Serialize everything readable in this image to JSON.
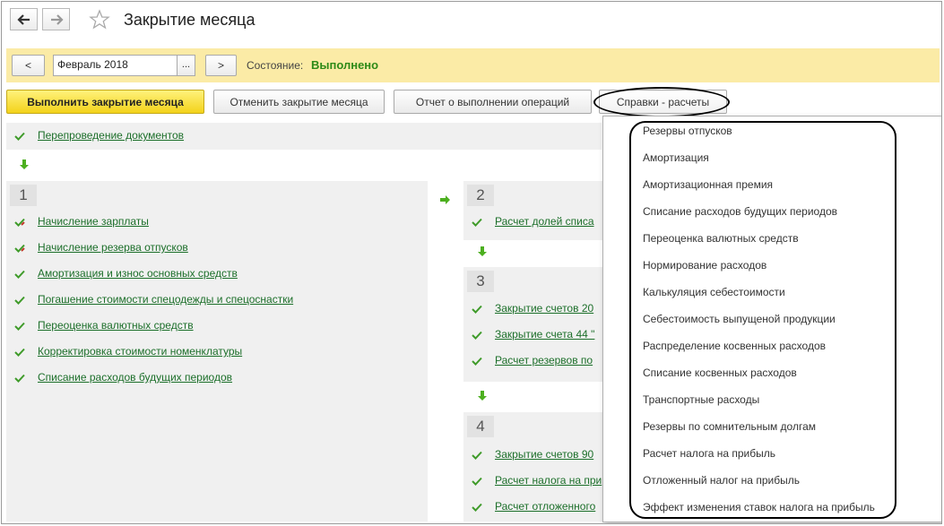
{
  "window": {
    "title": "Закрытие месяца"
  },
  "status": {
    "prev_label": "<",
    "period_value": "Февраль 2018",
    "period_picker": "...",
    "next_label": ">",
    "state_label": "Состояние:",
    "state_value": "Выполнено"
  },
  "toolbar": {
    "run_close": "Выполнить закрытие месяца",
    "cancel_close": "Отменить закрытие месяца",
    "report": "Отчет о выполнении операций",
    "references": "Справки - расчеты"
  },
  "pre_step": {
    "label": "Перепроведение документов"
  },
  "stage1": {
    "number": "1",
    "items": [
      "Начисление зарплаты",
      "Начисление резерва отпусков",
      "Амортизация и износ основных средств",
      "Погашение стоимости спецодежды и спецоснастки",
      "Переоценка валютных средств",
      "Корректировка стоимости номенклатуры",
      "Списание расходов будущих периодов"
    ]
  },
  "stage2": {
    "number": "2",
    "items": [
      "Расчет долей списа"
    ]
  },
  "stage3": {
    "number": "3",
    "items": [
      "Закрытие счетов 20",
      "Закрытие счета 44 \"",
      "Расчет резервов по"
    ]
  },
  "stage4": {
    "number": "4",
    "items": [
      "Закрытие счетов 90",
      "Расчет налога на при",
      "Расчет отложенного"
    ]
  },
  "references_menu": {
    "items": [
      "Резервы отпусков",
      "Амортизация",
      "Амортизационная премия",
      "Списание расходов будущих периодов",
      "Переоценка валютных средств",
      "Нормирование расходов",
      "Калькуляция себестоимости",
      "Себестоимость выпущеной продукции",
      "Распределение косвенных расходов",
      "Списание косвенных расходов",
      "Транспортные расходы",
      "Резервы по сомнительным долгам",
      "Расчет налога на прибыль",
      "Отложенный налог на прибыль",
      "Эффект изменения ставок налога на прибыль"
    ]
  },
  "colors": {
    "accent_green": "#2d8a17",
    "link_green": "#1c6f2a",
    "status_bar": "#fbeba6",
    "primary_button": "#f3d21a"
  },
  "icons": {
    "back": "arrow-left-icon",
    "forward": "arrow-right-icon",
    "favorite": "star-icon",
    "done": "check-icon",
    "done_with_note": "check-pencil-icon"
  }
}
